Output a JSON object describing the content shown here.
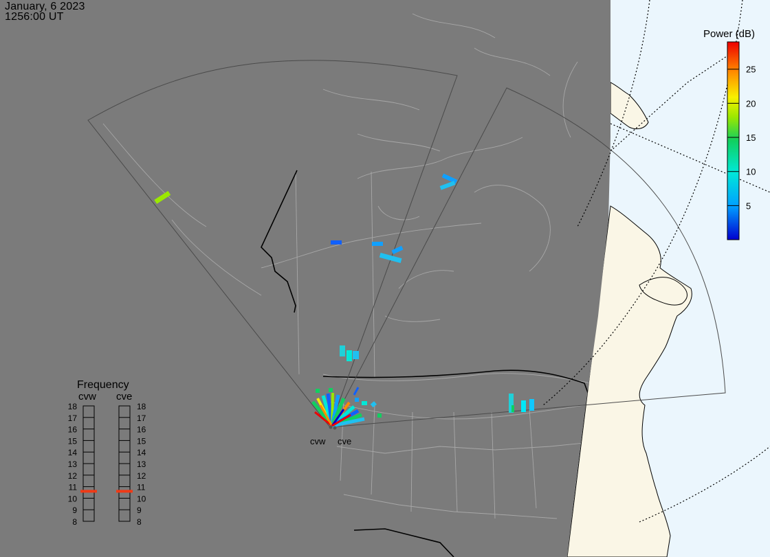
{
  "header": {
    "date": "January, 6 2023",
    "time": "1256:00 UT"
  },
  "colors": {
    "night": "#7b7b7b",
    "ocean_day": "#ebf6fd",
    "land_day": "#faf6e6",
    "border": "#c8c8c8",
    "coast": "#000000",
    "fov": "#4a4a4a",
    "freq_marker": "#ef3a16"
  },
  "colorbar": {
    "title": "Power (dB)",
    "range": [
      0,
      29
    ],
    "ticks": [
      5,
      10,
      15,
      20,
      25
    ],
    "tick_labels": [
      "5",
      "10",
      "15",
      "20",
      "25"
    ]
  },
  "radars": [
    {
      "code": "cvw",
      "label": "cvw"
    },
    {
      "code": "cve",
      "label": "cve"
    }
  ],
  "frequency": {
    "title": "Frequency",
    "column_labels": [
      "cvw",
      "cve"
    ],
    "ticks": [
      "18",
      "17",
      "16",
      "15",
      "14",
      "13",
      "12",
      "11",
      "10",
      "9",
      "8"
    ],
    "active": [
      10.6,
      10.6
    ]
  },
  "echoes": [
    {
      "region": "alaska",
      "power_db": 17
    },
    {
      "region": "central-canada",
      "power_db": 3
    },
    {
      "region": "central-canada",
      "power_db": 6
    },
    {
      "region": "central-canada",
      "power_db": 7
    },
    {
      "region": "hudson-bay",
      "power_db": 6
    },
    {
      "region": "alberta",
      "power_db": 10
    },
    {
      "region": "great-lakes",
      "power_db": 9
    },
    {
      "region": "great-lakes",
      "power_db": 6
    },
    {
      "region": "near-radar",
      "power_db": 14
    }
  ]
}
